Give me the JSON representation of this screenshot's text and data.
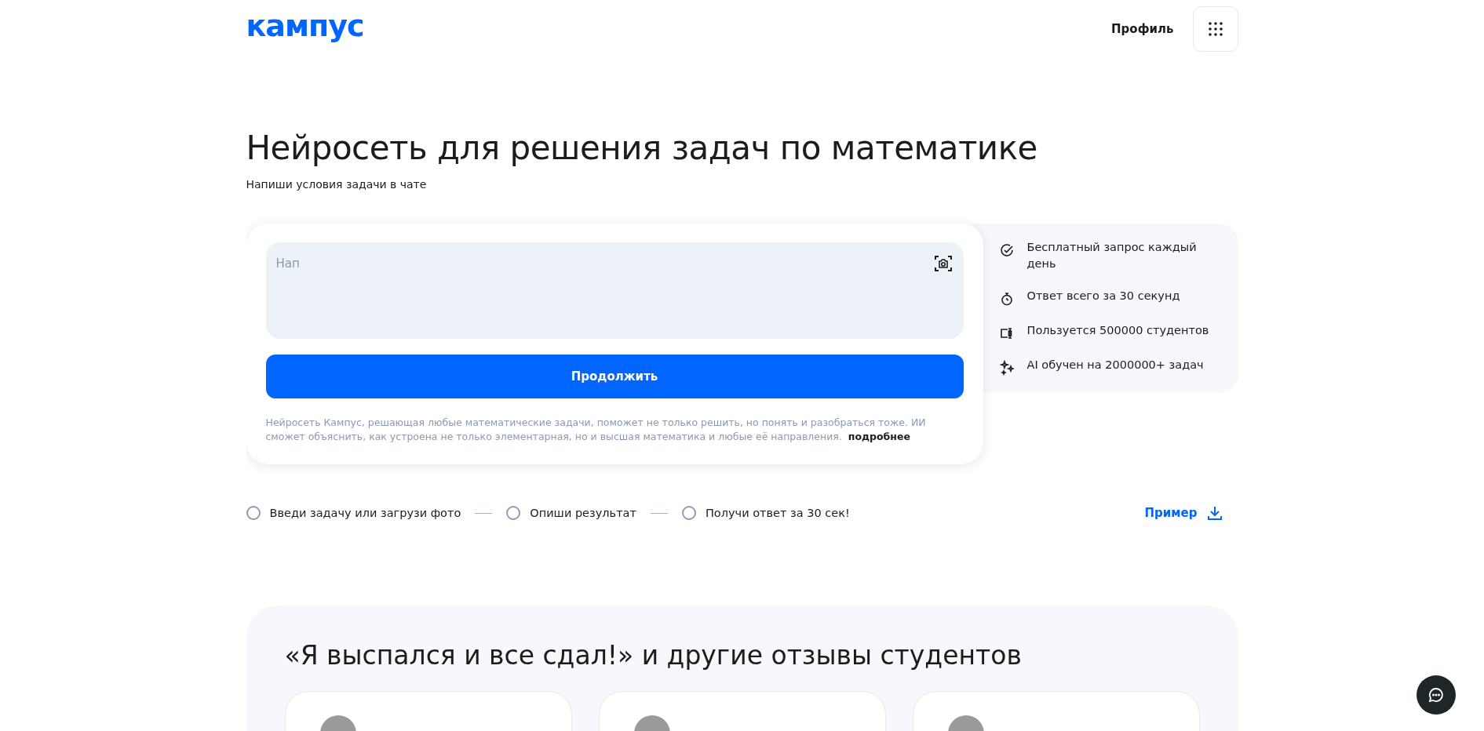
{
  "header": {
    "logo": "кампус",
    "profile_link": "Профиль"
  },
  "hero": {
    "title": "Нейросеть для решения задач по математике",
    "subtitle": "Напиши условия задачи в чате"
  },
  "chat": {
    "input": {
      "placeholder": "Нап"
    },
    "submit_button": "Продолжить",
    "description": "Нейросеть Кампус, решающая любые математические задачи, поможет не только решить, но понять и разобраться тоже. ИИ сможет объяснить, как устроена не только элементарная, но и высшая математика и любые её направления.",
    "more_link": "подробнее"
  },
  "benefits": [
    {
      "kind": "check",
      "text": "Бесплатный запрос каждый день"
    },
    {
      "kind": "timer",
      "text": "Ответ всего за 30 секунд"
    },
    {
      "kind": "users",
      "text": "Пользуется 500000 студентов"
    },
    {
      "kind": "sparkle",
      "text": "AI обучен на 2000000+ задач"
    }
  ],
  "steps": [
    {
      "label": "Введи задачу или загрузи фото",
      "checked": false
    },
    {
      "label": "Опиши результат",
      "checked": false
    },
    {
      "label": "Получи ответ за 30 сек!",
      "checked": false
    }
  ],
  "example_link": "Пример",
  "reviews": {
    "title": "«Я выспался и все сдал!» и другие отзывы студентов",
    "cards": [
      {
        "kind": "review"
      },
      {
        "kind": "review"
      },
      {
        "kind": "review"
      }
    ]
  }
}
